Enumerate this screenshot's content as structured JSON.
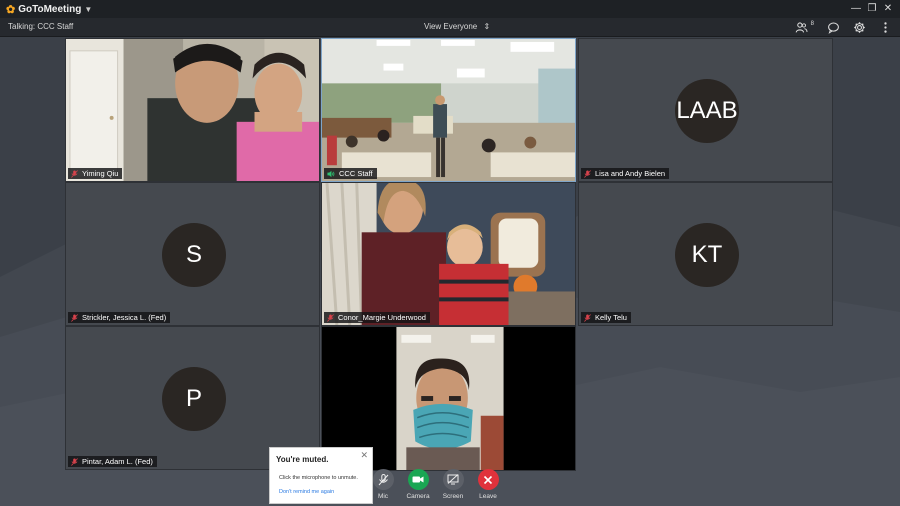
{
  "app": {
    "name": "GoToMeeting"
  },
  "infobar": {
    "talking": "Talking: CCC Staff",
    "view": "View Everyone",
    "attendee_count": "8"
  },
  "tiles": [
    {
      "name": "Yiming Qiu",
      "initials": "",
      "muted": true
    },
    {
      "name": "CCC Staff",
      "initials": "",
      "muted": false
    },
    {
      "name": "Lisa and Andy Bielen",
      "initials": "LAAB",
      "muted": true
    },
    {
      "name": "Strickler, Jessica L. (Fed)",
      "initials": "S",
      "muted": true
    },
    {
      "name": "Conor_Margie Underwood",
      "initials": "",
      "muted": true
    },
    {
      "name": "Kelly Telu",
      "initials": "KT",
      "muted": true
    },
    {
      "name": "Pintar, Adam L. (Fed)",
      "initials": "P",
      "muted": true
    },
    {
      "name": "",
      "initials": "",
      "muted": true
    }
  ],
  "controls": {
    "mic": "Mic",
    "camera": "Camera",
    "screen": "Screen",
    "leave": "Leave"
  },
  "popup": {
    "title": "You're muted.",
    "body": "Click the microphone to unmute.",
    "link": "Don't remind me again"
  },
  "colors": {
    "active_border": "#7fa5c9",
    "camera_green": "#1aa653",
    "leave_red": "#e0323c",
    "mic_off_red": "#d9434c",
    "link_blue": "#2a7ae2"
  }
}
